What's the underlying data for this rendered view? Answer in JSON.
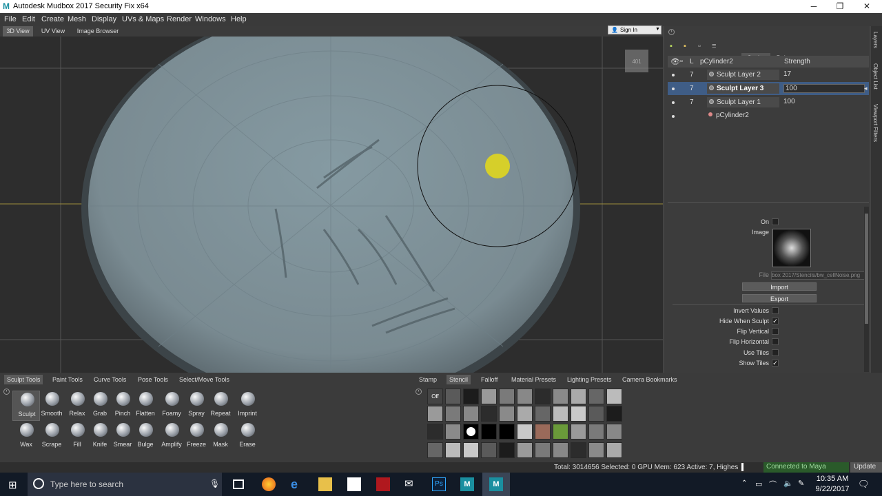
{
  "window": {
    "title": "Autodesk Mudbox 2017 Security Fix x64",
    "app_icon": "M",
    "minimize": "─",
    "maximize": "❐",
    "close": "✕"
  },
  "menu": [
    "File",
    "Edit",
    "Create",
    "Mesh",
    "Display",
    "UVs & Maps",
    "Render",
    "Windows",
    "Help"
  ],
  "view_tabs": [
    "3D View",
    "UV View",
    "Image Browser"
  ],
  "signin": {
    "label": "Sign In"
  },
  "viewport": {
    "hud_label": "401",
    "colors": {
      "background": "#2d2d2d",
      "surface": "#7e8f97",
      "grid": "#8a8a7a",
      "cursor": "#d6cf2a"
    }
  },
  "right_panel": {
    "mode_tabs": [
      "Sculpt",
      "Paint"
    ],
    "active_mode": "Sculpt",
    "layers_header": {
      "eye": "",
      "lock": "",
      "l": "L",
      "name": "pCylinder2",
      "strength": "Strength"
    },
    "layers": [
      {
        "num": "7",
        "name": "Sculpt Layer 2",
        "strength": "17",
        "selected": false
      },
      {
        "num": "7",
        "name": "Sculpt Layer 3",
        "strength": "100",
        "selected": true
      },
      {
        "num": "7",
        "name": "Sculpt Layer 1",
        "strength": "100",
        "selected": false
      }
    ],
    "base_object": "pCylinder2",
    "properties": {
      "on_label": "On",
      "image_label": "Image",
      "file_label": "File",
      "file_value": "box 2017/Stencils/bw_cellNoise.png",
      "import_label": "Import",
      "export_label": "Export",
      "checks": [
        {
          "label": "Invert Values",
          "checked": false
        },
        {
          "label": "Hide When Sculpt",
          "checked": true
        },
        {
          "label": "Flip Vertical",
          "checked": false
        },
        {
          "label": "Flip Horizontal",
          "checked": false
        },
        {
          "label": "Use Tiles",
          "checked": false
        },
        {
          "label": "Show Tiles",
          "checked": true
        }
      ]
    },
    "side_tabs": [
      "Layers",
      "Object List",
      "Viewport Filters"
    ]
  },
  "tool_tabs": [
    "Sculpt Tools",
    "Paint Tools",
    "Curve Tools",
    "Pose Tools",
    "Select/Move Tools"
  ],
  "tools_row1": [
    "Sculpt",
    "Smooth",
    "Relax",
    "Grab",
    "Pinch",
    "Flatten",
    "Foamy",
    "Spray",
    "Repeat",
    "Imprint"
  ],
  "tools_row2": [
    "Wax",
    "Scrape",
    "Fill",
    "Knife",
    "Smear",
    "Bulge",
    "Amplify",
    "Freeze",
    "Mask",
    "Erase"
  ],
  "tray_tabs": [
    "Stamp",
    "Stencil",
    "Falloff",
    "Material Presets",
    "Lighting Presets",
    "Camera Bookmarks"
  ],
  "active_tray_tab": "Stencil",
  "stencil_off": "Off",
  "status": {
    "text": "Total: 3014656  Selected: 0 GPU Mem: 623  Active: 7, Highes",
    "connected": "Connected to Maya",
    "update": "Update"
  },
  "taskbar": {
    "search_placeholder": "Type here to search",
    "time": "10:35 AM",
    "date": "9/22/2017"
  }
}
